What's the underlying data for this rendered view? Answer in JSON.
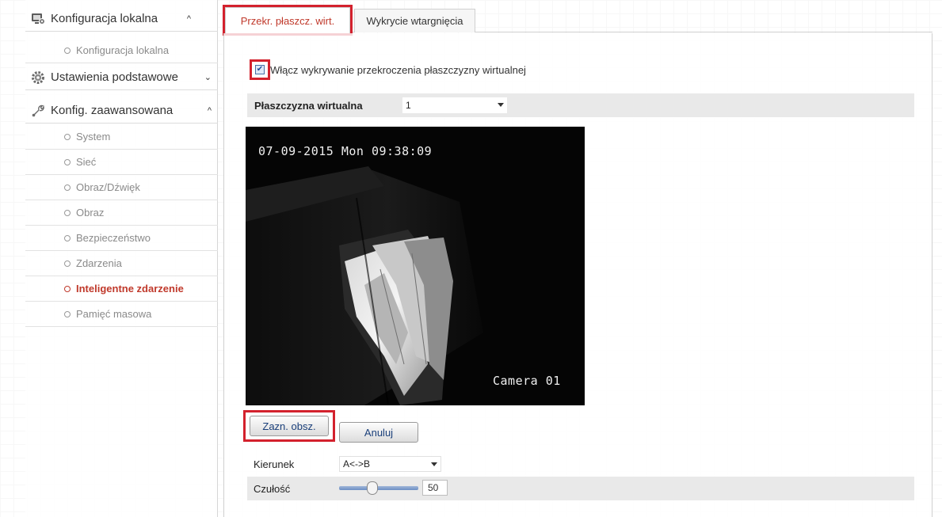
{
  "sidebar": {
    "local_config": {
      "label": "Konfiguracja lokalna",
      "icon": "computer-settings-icon",
      "items": [
        "Konfiguracja lokalna"
      ]
    },
    "basic_settings": {
      "label": "Ustawienia podstawowe",
      "icon": "gear-icon"
    },
    "advanced_config": {
      "label": "Konfig. zaawansowana",
      "icon": "wrench-icon",
      "items": [
        "System",
        "Sieć",
        "Obraz/Dźwięk",
        "Obraz",
        "Bezpieczeństwo",
        "Zdarzenia",
        "Inteligentne zdarzenie",
        "Pamięć masowa"
      ],
      "active_item": "Inteligentne zdarzenie"
    }
  },
  "tabs": [
    {
      "label": "Przekr. płaszcz. wirt.",
      "active": true
    },
    {
      "label": "Wykrycie wtargnięcia",
      "active": false
    }
  ],
  "enable": {
    "label": "Włącz wykrywanie przekroczenia płaszczyzny wirtualnej",
    "checked": true
  },
  "plane": {
    "label": "Płaszczyzna wirtualna",
    "value": "1"
  },
  "video": {
    "timestamp": "07-09-2015 Mon 09:38:09",
    "camera_name": "Camera 01"
  },
  "buttons": {
    "draw_area": "Zazn. obsz.",
    "cancel": "Anuluj"
  },
  "direction": {
    "label": "Kierunek",
    "value": "A<->B"
  },
  "sensitivity": {
    "label": "Czułość",
    "value": "50",
    "fraction": 0.5
  },
  "colors": {
    "accent_red": "#d3212d",
    "active_text": "#c0392b",
    "button_text": "#1a3f7a"
  }
}
